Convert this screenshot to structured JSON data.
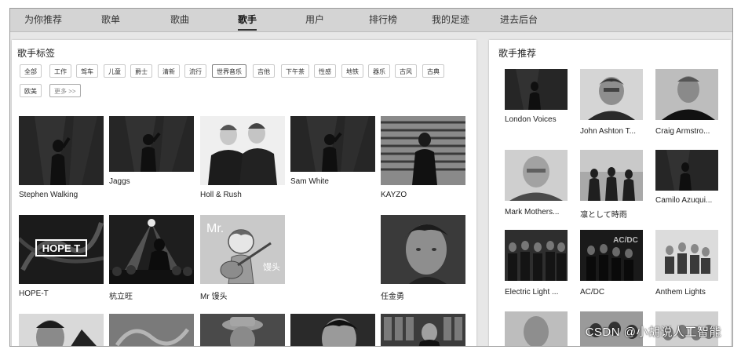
{
  "nav": {
    "items": [
      "为你推荐",
      "歌单",
      "歌曲",
      "歌手",
      "用户",
      "排行榜",
      "我的足迹",
      "进去后台"
    ],
    "active": "歌手"
  },
  "tags_section": {
    "title": "歌手标签",
    "tags": [
      "全部",
      "工作",
      "驾车",
      "儿童",
      "爵士",
      "清新",
      "流行",
      "世界音乐",
      "吉他",
      "下午茶",
      "性感",
      "地铁",
      "器乐",
      "古风",
      "古典",
      "欧美"
    ],
    "selected": "世界音乐",
    "more": "更多 >>"
  },
  "singers": [
    {
      "name": "Stephen Walking",
      "image": "silhouette-stage"
    },
    {
      "name": "Jaggs",
      "image": "silhouette-stage"
    },
    {
      "name": "Holl & Rush",
      "image": "duo-portrait"
    },
    {
      "name": "Sam White",
      "image": "silhouette-stage"
    },
    {
      "name": "KAYZO",
      "image": "blinds-portrait"
    },
    {
      "name": "HOPE-T",
      "image": "logo-graphic"
    },
    {
      "name": "杭立旺",
      "image": "concert-crowd"
    },
    {
      "name": "Mr 馒头",
      "image": "cartoon-guitar"
    },
    {
      "name": "任金勇",
      "image": "face-portrait"
    }
  ],
  "recommend": {
    "title": "歌手推荐",
    "items": [
      {
        "name": "London Voices",
        "image": "silhouette-stage"
      },
      {
        "name": "John Ashton T...",
        "image": "man-portrait"
      },
      {
        "name": "Craig Armstro...",
        "image": "man-portrait-dark"
      },
      {
        "name": "Mark Mothers...",
        "image": "man-portrait"
      },
      {
        "name": "凛として時雨",
        "image": "band-outdoor"
      },
      {
        "name": "Camilo Azuqui...",
        "image": "silhouette-stage"
      },
      {
        "name": "Electric Light ...",
        "image": "band-group"
      },
      {
        "name": "AC/DC",
        "image": "band-dark"
      },
      {
        "name": "Anthem Lights",
        "image": "band-light"
      }
    ]
  },
  "watermark": "CSDN @小胡说人工智能",
  "colors": {
    "nav_bg": "#d4d4d4",
    "page_bg": "#e7e7e7",
    "panel_bg": "#ffffff",
    "tag_border": "#c9c9c9"
  }
}
